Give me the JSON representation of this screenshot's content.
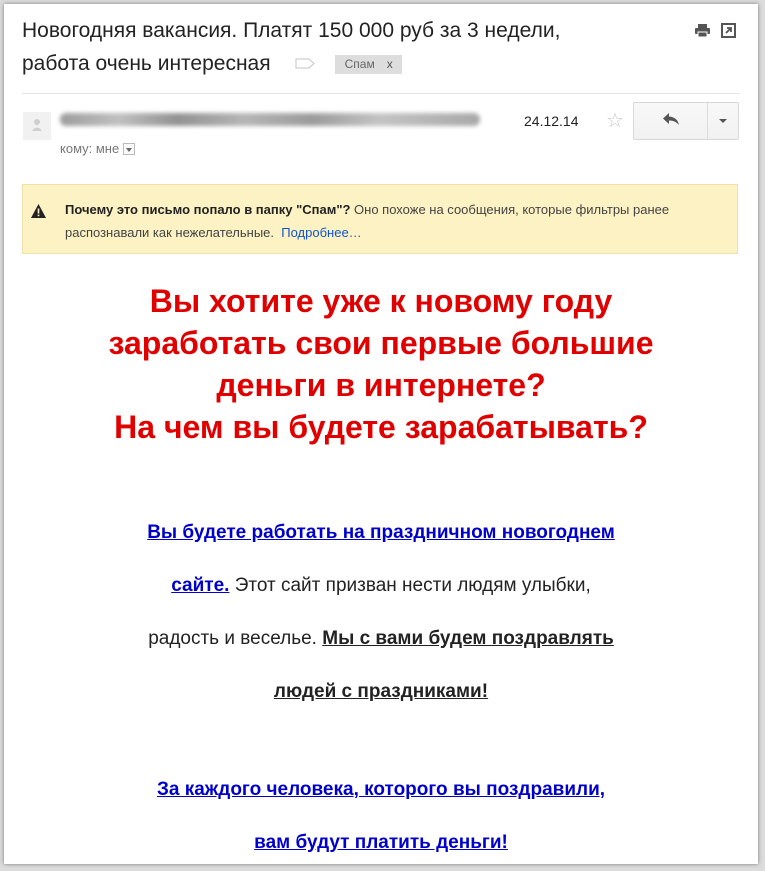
{
  "email": {
    "subject": "Новогодняя вакансия. Платят 150 000 руб за 3 недели, работа очень интересная",
    "spam_label": "Спам",
    "spam_remove": "x",
    "date": "24.12.14",
    "to_label": "кому: мне",
    "warning": {
      "bold": "Почему это письмо попало в папку \"Спам\"?",
      "text": " Оно похоже на сообщения, которые фильтры ранее распознавали как нежелательные.",
      "link": "Подробнее…"
    }
  },
  "content": {
    "headline_1": "Вы хотите уже к новому году",
    "headline_2": "заработать свои первые большие",
    "headline_3": "деньги в интернете?",
    "headline_4": "На чем вы будете зарабатывать?",
    "link_1_a": "Вы будете работать на праздничном новогоднем",
    "link_1_b": "сайте.",
    "text_1_a": " Этот сайт призван нести людям улыбки,",
    "text_1_b": "радость и веселье. ",
    "bold_1_a": "Мы с вами будем поздравлять",
    "bold_1_b": "людей с праздниками!",
    "link_2_a": "За каждого человека, которого вы поздравили,",
    "link_2_b": "вам будут платить деньги!"
  },
  "colors": {
    "headline": "#e00000",
    "link": "#0000cc",
    "warning_bg": "#fcf2c3"
  },
  "icons": [
    "print-icon",
    "new-window-icon",
    "label-icon",
    "avatar-icon",
    "star-icon",
    "reply-icon",
    "chevron-down-icon",
    "warning-icon"
  ]
}
